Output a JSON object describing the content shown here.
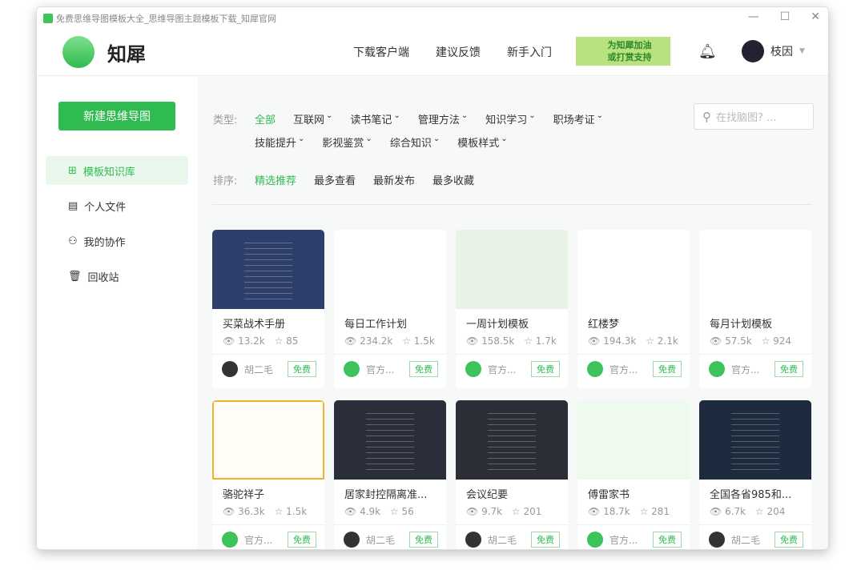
{
  "window": {
    "title": "免费思维导图模板大全_思维导图主题模板下载_知犀官网"
  },
  "header": {
    "logo": "知犀",
    "nav": [
      "下载客户端",
      "建议反馈",
      "新手入门"
    ],
    "promo": [
      "为知犀加油",
      "或打赏支持"
    ],
    "user": "枝因"
  },
  "sidebar": {
    "new_button": "新建思维导图",
    "items": [
      {
        "label": "模板知识库",
        "icon": "grid-icon"
      },
      {
        "label": "个人文件",
        "icon": "file-icon"
      },
      {
        "label": "我的协作",
        "icon": "users-icon"
      },
      {
        "label": "回收站",
        "icon": "trash-icon"
      }
    ]
  },
  "filters": {
    "type_label": "类型:",
    "types_row1": [
      "全部",
      "互联网",
      "读书笔记",
      "管理方法",
      "知识学习",
      "职场考证"
    ],
    "types_row2": [
      "技能提升",
      "影视鉴赏",
      "综合知识",
      "模板样式"
    ],
    "sort_label": "排序:",
    "sorts": [
      "精选推荐",
      "最多查看",
      "最新发布",
      "最多收藏"
    ],
    "search_placeholder": "在找脑图? ..."
  },
  "cards": [
    {
      "title": "买菜战术手册",
      "views": "13.2k",
      "stars": "85",
      "author": "胡二毛",
      "badge": "免费",
      "thumb": "#2e3f6b"
    },
    {
      "title": "每日工作计划",
      "views": "234.2k",
      "stars": "1.5k",
      "author": "官方...",
      "badge": "免费",
      "thumb": "#ffffff"
    },
    {
      "title": "一周计划模板",
      "views": "158.5k",
      "stars": "1.7k",
      "author": "官方...",
      "badge": "免费",
      "thumb": "#e9f3e5"
    },
    {
      "title": "红楼梦",
      "views": "194.3k",
      "stars": "2.1k",
      "author": "官方...",
      "badge": "免费",
      "thumb": "#ffffff"
    },
    {
      "title": "每月计划模板",
      "views": "57.5k",
      "stars": "924",
      "author": "官方...",
      "badge": "免费",
      "thumb": "#ffffff"
    },
    {
      "title": "骆驼祥子",
      "views": "36.3k",
      "stars": "1.5k",
      "author": "官方...",
      "badge": "免费",
      "thumb": "#fffdf5"
    },
    {
      "title": "居家封控隔离准...",
      "views": "4.9k",
      "stars": "56",
      "author": "胡二毛",
      "badge": "免费",
      "thumb": "#2a2d3a"
    },
    {
      "title": "会议纪要",
      "views": "9.7k",
      "stars": "201",
      "author": "胡二毛",
      "badge": "免费",
      "thumb": "#2b2e36"
    },
    {
      "title": "傅雷家书",
      "views": "18.7k",
      "stars": "281",
      "author": "官方...",
      "badge": "免费",
      "thumb": "#eefaee"
    },
    {
      "title": "全国各省985和...",
      "views": "6.7k",
      "stars": "204",
      "author": "胡二毛",
      "badge": "免费",
      "thumb": "#1e2a3e"
    }
  ]
}
